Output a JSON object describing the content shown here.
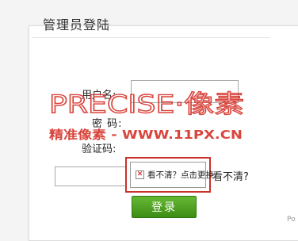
{
  "login": {
    "title": "管理员登陆",
    "username_label": "用户名:",
    "password_label": "密   码:",
    "captcha_label": "验证码:",
    "captcha_alt": "看不清？点击更换",
    "refresh_text": "看不清?",
    "login_button": "登录",
    "corner_text": "Po"
  },
  "watermark": {
    "line1": "PRECISE·像素",
    "line2": "精准像素 - WWW.11PX.CN",
    "color": "#d9453d"
  },
  "colors": {
    "button_green": "#4f9f22",
    "captcha_border": "#c9312b"
  },
  "icons": {
    "captcha_image": "broken-image-icon"
  }
}
